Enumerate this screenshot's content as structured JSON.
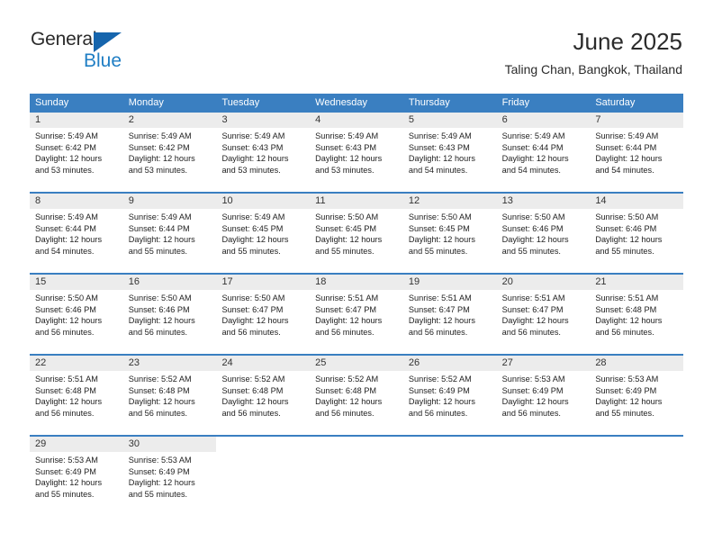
{
  "brand": {
    "name_top": "General",
    "name_bottom": "Blue",
    "flag_icon": "blue-flag-triangle",
    "accent_color": "#1f7ec4"
  },
  "header": {
    "title": "June 2025",
    "subtitle": "Taling Chan, Bangkok, Thailand"
  },
  "calendar": {
    "header_color": "#3a7fc1",
    "day_band_color": "#ececec",
    "weekdays": [
      "Sunday",
      "Monday",
      "Tuesday",
      "Wednesday",
      "Thursday",
      "Friday",
      "Saturday"
    ],
    "weeks": [
      [
        {
          "day": "1",
          "sunrise": "Sunrise: 5:49 AM",
          "sunset": "Sunset: 6:42 PM",
          "daylight1": "Daylight: 12 hours",
          "daylight2": "and 53 minutes."
        },
        {
          "day": "2",
          "sunrise": "Sunrise: 5:49 AM",
          "sunset": "Sunset: 6:42 PM",
          "daylight1": "Daylight: 12 hours",
          "daylight2": "and 53 minutes."
        },
        {
          "day": "3",
          "sunrise": "Sunrise: 5:49 AM",
          "sunset": "Sunset: 6:43 PM",
          "daylight1": "Daylight: 12 hours",
          "daylight2": "and 53 minutes."
        },
        {
          "day": "4",
          "sunrise": "Sunrise: 5:49 AM",
          "sunset": "Sunset: 6:43 PM",
          "daylight1": "Daylight: 12 hours",
          "daylight2": "and 53 minutes."
        },
        {
          "day": "5",
          "sunrise": "Sunrise: 5:49 AM",
          "sunset": "Sunset: 6:43 PM",
          "daylight1": "Daylight: 12 hours",
          "daylight2": "and 54 minutes."
        },
        {
          "day": "6",
          "sunrise": "Sunrise: 5:49 AM",
          "sunset": "Sunset: 6:44 PM",
          "daylight1": "Daylight: 12 hours",
          "daylight2": "and 54 minutes."
        },
        {
          "day": "7",
          "sunrise": "Sunrise: 5:49 AM",
          "sunset": "Sunset: 6:44 PM",
          "daylight1": "Daylight: 12 hours",
          "daylight2": "and 54 minutes."
        }
      ],
      [
        {
          "day": "8",
          "sunrise": "Sunrise: 5:49 AM",
          "sunset": "Sunset: 6:44 PM",
          "daylight1": "Daylight: 12 hours",
          "daylight2": "and 54 minutes."
        },
        {
          "day": "9",
          "sunrise": "Sunrise: 5:49 AM",
          "sunset": "Sunset: 6:44 PM",
          "daylight1": "Daylight: 12 hours",
          "daylight2": "and 55 minutes."
        },
        {
          "day": "10",
          "sunrise": "Sunrise: 5:49 AM",
          "sunset": "Sunset: 6:45 PM",
          "daylight1": "Daylight: 12 hours",
          "daylight2": "and 55 minutes."
        },
        {
          "day": "11",
          "sunrise": "Sunrise: 5:50 AM",
          "sunset": "Sunset: 6:45 PM",
          "daylight1": "Daylight: 12 hours",
          "daylight2": "and 55 minutes."
        },
        {
          "day": "12",
          "sunrise": "Sunrise: 5:50 AM",
          "sunset": "Sunset: 6:45 PM",
          "daylight1": "Daylight: 12 hours",
          "daylight2": "and 55 minutes."
        },
        {
          "day": "13",
          "sunrise": "Sunrise: 5:50 AM",
          "sunset": "Sunset: 6:46 PM",
          "daylight1": "Daylight: 12 hours",
          "daylight2": "and 55 minutes."
        },
        {
          "day": "14",
          "sunrise": "Sunrise: 5:50 AM",
          "sunset": "Sunset: 6:46 PM",
          "daylight1": "Daylight: 12 hours",
          "daylight2": "and 55 minutes."
        }
      ],
      [
        {
          "day": "15",
          "sunrise": "Sunrise: 5:50 AM",
          "sunset": "Sunset: 6:46 PM",
          "daylight1": "Daylight: 12 hours",
          "daylight2": "and 56 minutes."
        },
        {
          "day": "16",
          "sunrise": "Sunrise: 5:50 AM",
          "sunset": "Sunset: 6:46 PM",
          "daylight1": "Daylight: 12 hours",
          "daylight2": "and 56 minutes."
        },
        {
          "day": "17",
          "sunrise": "Sunrise: 5:50 AM",
          "sunset": "Sunset: 6:47 PM",
          "daylight1": "Daylight: 12 hours",
          "daylight2": "and 56 minutes."
        },
        {
          "day": "18",
          "sunrise": "Sunrise: 5:51 AM",
          "sunset": "Sunset: 6:47 PM",
          "daylight1": "Daylight: 12 hours",
          "daylight2": "and 56 minutes."
        },
        {
          "day": "19",
          "sunrise": "Sunrise: 5:51 AM",
          "sunset": "Sunset: 6:47 PM",
          "daylight1": "Daylight: 12 hours",
          "daylight2": "and 56 minutes."
        },
        {
          "day": "20",
          "sunrise": "Sunrise: 5:51 AM",
          "sunset": "Sunset: 6:47 PM",
          "daylight1": "Daylight: 12 hours",
          "daylight2": "and 56 minutes."
        },
        {
          "day": "21",
          "sunrise": "Sunrise: 5:51 AM",
          "sunset": "Sunset: 6:48 PM",
          "daylight1": "Daylight: 12 hours",
          "daylight2": "and 56 minutes."
        }
      ],
      [
        {
          "day": "22",
          "sunrise": "Sunrise: 5:51 AM",
          "sunset": "Sunset: 6:48 PM",
          "daylight1": "Daylight: 12 hours",
          "daylight2": "and 56 minutes."
        },
        {
          "day": "23",
          "sunrise": "Sunrise: 5:52 AM",
          "sunset": "Sunset: 6:48 PM",
          "daylight1": "Daylight: 12 hours",
          "daylight2": "and 56 minutes."
        },
        {
          "day": "24",
          "sunrise": "Sunrise: 5:52 AM",
          "sunset": "Sunset: 6:48 PM",
          "daylight1": "Daylight: 12 hours",
          "daylight2": "and 56 minutes."
        },
        {
          "day": "25",
          "sunrise": "Sunrise: 5:52 AM",
          "sunset": "Sunset: 6:48 PM",
          "daylight1": "Daylight: 12 hours",
          "daylight2": "and 56 minutes."
        },
        {
          "day": "26",
          "sunrise": "Sunrise: 5:52 AM",
          "sunset": "Sunset: 6:49 PM",
          "daylight1": "Daylight: 12 hours",
          "daylight2": "and 56 minutes."
        },
        {
          "day": "27",
          "sunrise": "Sunrise: 5:53 AM",
          "sunset": "Sunset: 6:49 PM",
          "daylight1": "Daylight: 12 hours",
          "daylight2": "and 56 minutes."
        },
        {
          "day": "28",
          "sunrise": "Sunrise: 5:53 AM",
          "sunset": "Sunset: 6:49 PM",
          "daylight1": "Daylight: 12 hours",
          "daylight2": "and 55 minutes."
        }
      ],
      [
        {
          "day": "29",
          "sunrise": "Sunrise: 5:53 AM",
          "sunset": "Sunset: 6:49 PM",
          "daylight1": "Daylight: 12 hours",
          "daylight2": "and 55 minutes."
        },
        {
          "day": "30",
          "sunrise": "Sunrise: 5:53 AM",
          "sunset": "Sunset: 6:49 PM",
          "daylight1": "Daylight: 12 hours",
          "daylight2": "and 55 minutes."
        },
        {
          "day": "",
          "sunrise": "",
          "sunset": "",
          "daylight1": "",
          "daylight2": ""
        },
        {
          "day": "",
          "sunrise": "",
          "sunset": "",
          "daylight1": "",
          "daylight2": ""
        },
        {
          "day": "",
          "sunrise": "",
          "sunset": "",
          "daylight1": "",
          "daylight2": ""
        },
        {
          "day": "",
          "sunrise": "",
          "sunset": "",
          "daylight1": "",
          "daylight2": ""
        },
        {
          "day": "",
          "sunrise": "",
          "sunset": "",
          "daylight1": "",
          "daylight2": ""
        }
      ]
    ]
  }
}
